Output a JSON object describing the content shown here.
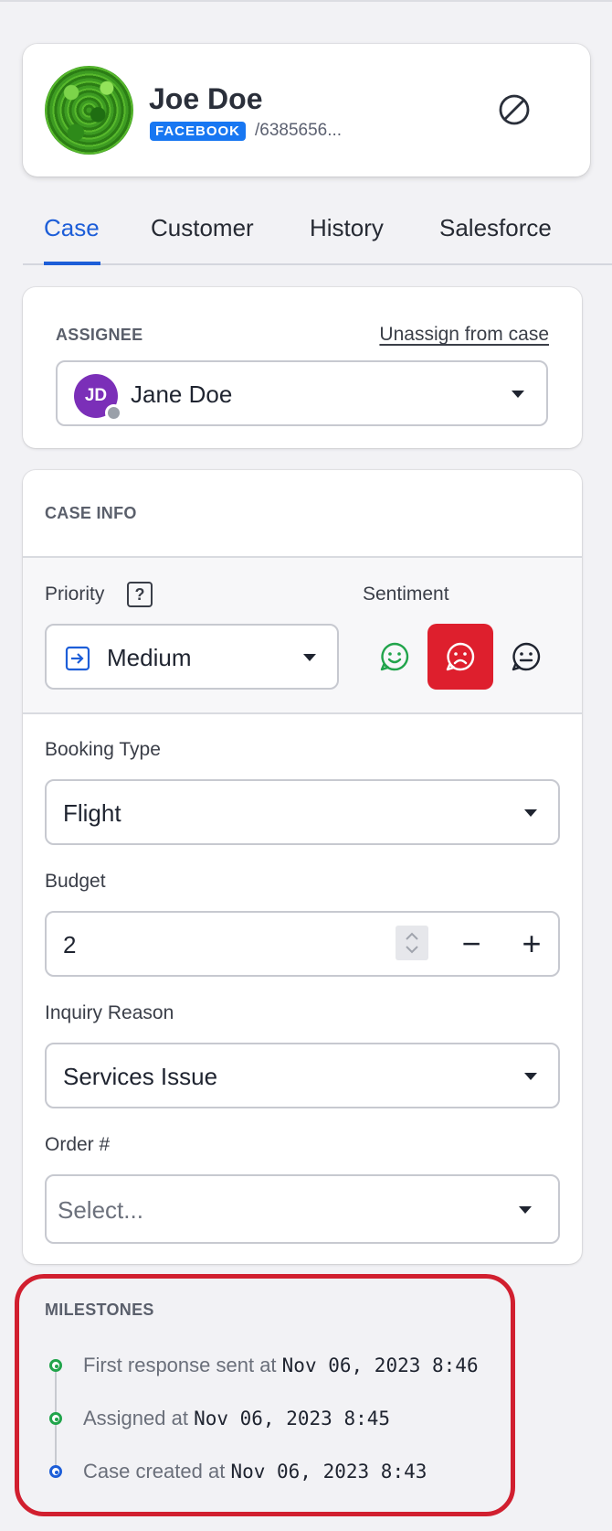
{
  "customer": {
    "name": "Joe Doe",
    "channel": "FACEBOOK",
    "id": "/6385656...",
    "avatar_icon": "customer-avatar-photo",
    "action_icon": "block-icon"
  },
  "tabs": [
    {
      "label": "Case",
      "active": true
    },
    {
      "label": "Customer",
      "active": false
    },
    {
      "label": "History",
      "active": false
    },
    {
      "label": "Salesforce",
      "active": false
    }
  ],
  "assignee": {
    "section_label": "ASSIGNEE",
    "unassign_label": "Unassign from case",
    "initials": "JD",
    "name": "Jane Doe"
  },
  "case_info": {
    "section_label": "CASE INFO",
    "priority": {
      "label": "Priority",
      "help": "?",
      "value": "Medium",
      "icon": "priority-arrow-icon"
    },
    "sentiment": {
      "label": "Sentiment",
      "options": [
        "positive",
        "negative",
        "neutral"
      ],
      "selected": "negative"
    },
    "booking_type": {
      "label": "Booking Type",
      "value": "Flight"
    },
    "budget": {
      "label": "Budget",
      "value": "2",
      "decrement": "−",
      "increment": "+"
    },
    "inquiry_reason": {
      "label": "Inquiry Reason",
      "value": "Services Issue"
    },
    "order": {
      "label": "Order #",
      "placeholder": "Select..."
    }
  },
  "milestones": {
    "section_label": "MILESTONES",
    "items": [
      {
        "text": "First response sent at ",
        "time": "Nov 06, 2023 8:46",
        "status": "green"
      },
      {
        "text": "Assigned at ",
        "time": "Nov 06, 2023 8:45",
        "status": "green"
      },
      {
        "text": "Case created at ",
        "time": "Nov 06, 2023 8:43",
        "status": "blue"
      }
    ]
  },
  "colors": {
    "accent": "#1d5ed8",
    "facebook": "#1877f2",
    "negative": "#de1f2d",
    "positive": "#21a44b",
    "highlight": "#d11f2f"
  }
}
